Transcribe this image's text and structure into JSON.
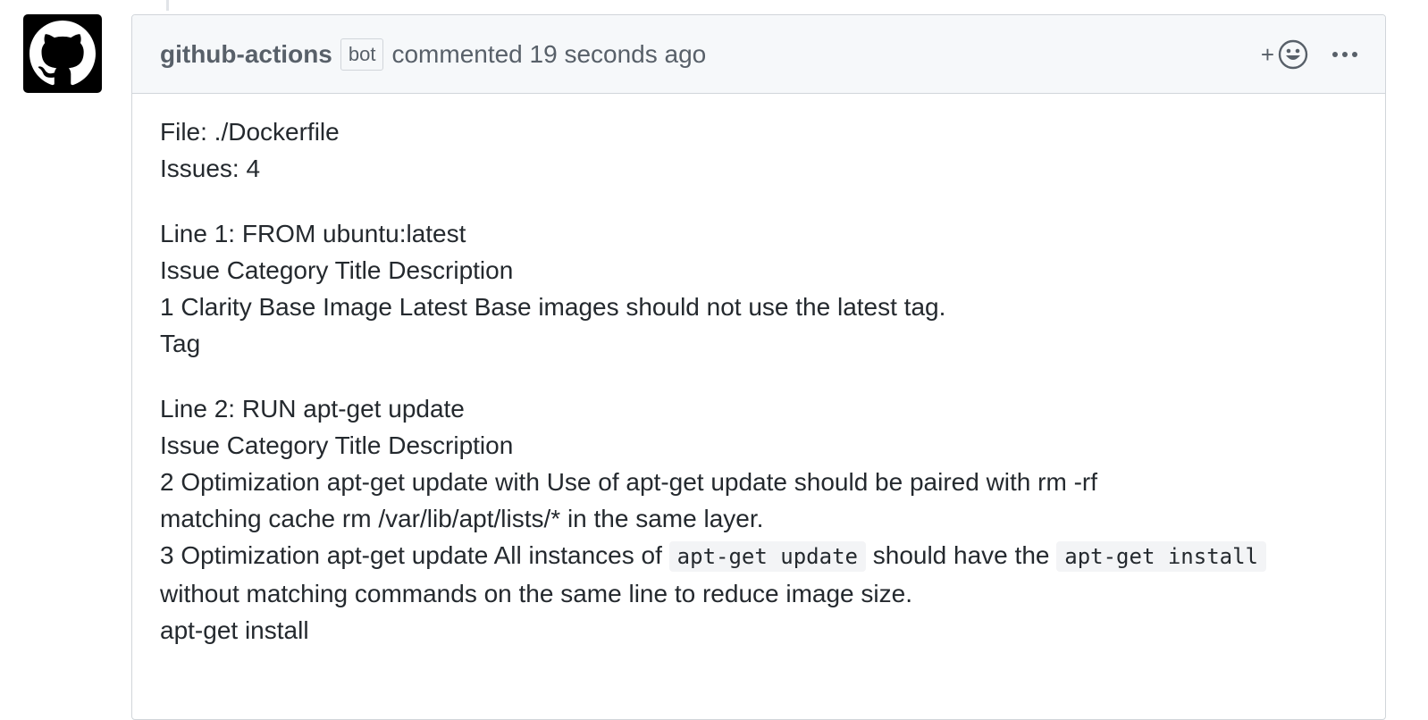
{
  "comment": {
    "author": "github-actions",
    "bot_label": "bot",
    "time": "commented 19 seconds ago",
    "reaction_plus": "+"
  },
  "body": {
    "file_line": "File: ./Dockerfile",
    "issues_line": "Issues: 4",
    "section1": {
      "heading": "Line 1: FROM ubuntu:latest",
      "table_header": "Issue Category Title Description",
      "row1": "1 Clarity Base Image Latest Base images should not use the latest tag.",
      "row1_wrap": "Tag"
    },
    "section2": {
      "heading": "Line 2: RUN apt-get update",
      "table_header": "Issue Category Title Description",
      "row2": "2 Optimization apt-get update with Use of apt-get update should be paired with rm -rf",
      "row2_wrap": "matching cache rm /var/lib/apt/lists/* in the same layer.",
      "row3_prefix": "3 Optimization apt-get update All instances of ",
      "row3_code1": "apt-get update",
      "row3_mid": " should have the ",
      "row3_code2": "apt-get install",
      "row3_wrap": "without matching commands on the same line to reduce image size.",
      "row3_wrap2": "apt-get install"
    }
  }
}
